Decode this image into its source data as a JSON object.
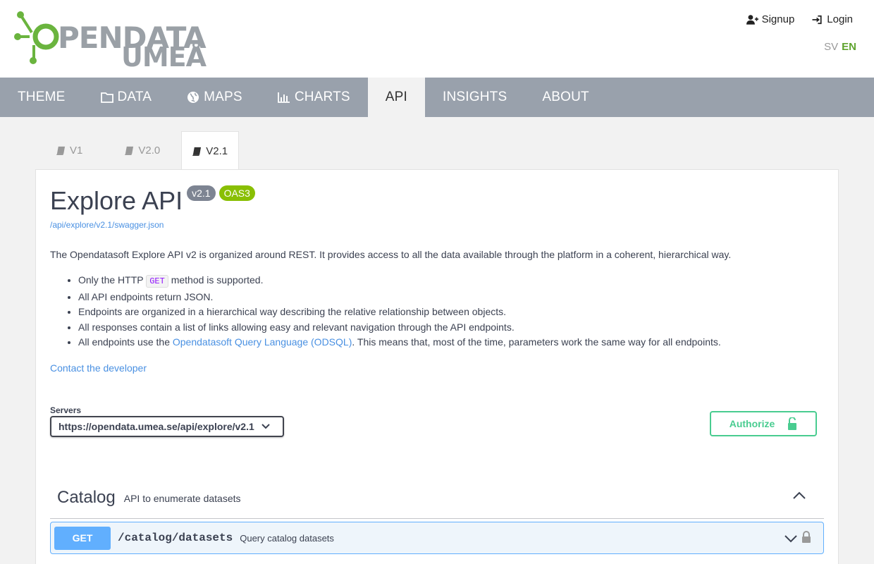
{
  "header": {
    "logo_text": "OPENDATA UMEÅ",
    "signup_label": "Signup",
    "login_label": "Login",
    "lang_sv": "SV",
    "lang_en": "EN"
  },
  "nav": {
    "items": [
      {
        "label": "THEME",
        "icon": ""
      },
      {
        "label": "DATA",
        "icon": "folder-icon"
      },
      {
        "label": "MAPS",
        "icon": "globe-icon"
      },
      {
        "label": "CHARTS",
        "icon": "bar-chart-icon"
      },
      {
        "label": "API",
        "icon": ""
      },
      {
        "label": "INSIGHTS",
        "icon": ""
      },
      {
        "label": "ABOUT",
        "icon": ""
      }
    ],
    "active": "API"
  },
  "version_tabs": [
    {
      "label": "V1",
      "icon": "book-icon"
    },
    {
      "label": "V2.0",
      "icon": "book-icon"
    },
    {
      "label": "V2.1",
      "icon": "book-icon"
    }
  ],
  "api": {
    "title": "Explore API",
    "version_badge": "v2.1",
    "oas_badge": "OAS3",
    "spec_url": "/api/explore/v2.1/swagger.json",
    "description": "The Opendatasoft Explore API v2 is organized around REST. It provides access to all the data available through the platform in a coherent, hierarchical way.",
    "bullet1_pre": "Only the HTTP ",
    "bullet1_code": "GET",
    "bullet1_post": " method is supported.",
    "bullet2": "All API endpoints return JSON.",
    "bullet3": "Endpoints are organized in a hierarchical way describing the relative relationship between objects.",
    "bullet4": "All responses contain a list of links allowing easy and relevant navigation through the API endpoints.",
    "bullet5_pre": "All endpoints use the ",
    "bullet5_link": "Opendatasoft Query Language (ODSQL)",
    "bullet5_post": ". This means that, most of the time, parameters work the same way for all endpoints.",
    "contact_label": "Contact the developer"
  },
  "servers": {
    "label": "Servers",
    "selected": "https://opendata.umea.se/api/explore/v2.1"
  },
  "authorize": {
    "label": "Authorize"
  },
  "section": {
    "title": "Catalog",
    "subtitle": "API to enumerate datasets"
  },
  "operation": {
    "method": "GET",
    "path": "/catalog/datasets",
    "summary": "Query catalog datasets"
  },
  "colors": {
    "brand_green": "#5fa32e",
    "nav_bg": "#99a1ac",
    "get_blue": "#61affe",
    "authorize_green": "#49cc90",
    "oas_badge": "#89bf04"
  }
}
